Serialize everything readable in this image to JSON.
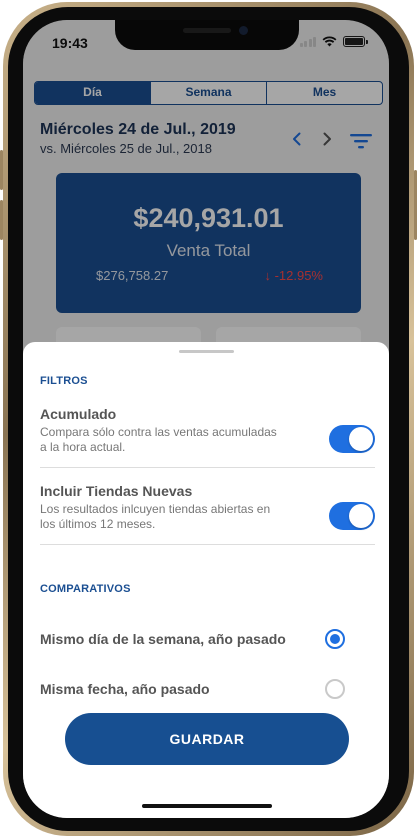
{
  "status_bar": {
    "time": "19:43"
  },
  "tabs": [
    {
      "label": "Día",
      "active": true
    },
    {
      "label": "Semana",
      "active": false
    },
    {
      "label": "Mes",
      "active": false
    }
  ],
  "header": {
    "date_title": "Miércoles 24 de Jul., 2019",
    "date_compare": "vs. Miércoles 25 de Jul., 2018"
  },
  "icons": {
    "prev": "chevron-left-icon",
    "next": "chevron-right-icon",
    "filter": "filter-icon"
  },
  "sales_card": {
    "amount": "$240,931.01",
    "label": "Venta Total",
    "previous_amount": "$276,758.27",
    "change": "↓ -12.95%"
  },
  "sheet": {
    "filters_title": "FILTROS",
    "filters": [
      {
        "title": "Acumulado",
        "description": "Compara sólo contra las ventas acumuladas a la hora actual.",
        "enabled": true
      },
      {
        "title": "Incluir Tiendas Nuevas",
        "description": "Los resultados inlcuyen tiendas abiertas en los últimos 12 meses.",
        "enabled": true
      }
    ],
    "comparatives_title": "COMPARATIVOS",
    "comparatives": [
      {
        "label": "Mismo día de la semana, año pasado",
        "selected": true
      },
      {
        "label": "Misma fecha, año pasado",
        "selected": false
      }
    ],
    "save_label": "GUARDAR"
  },
  "colors": {
    "brand_blue": "#1b4f92",
    "toggle_on": "#1f6fe0",
    "negative": "#ff4a4a"
  }
}
